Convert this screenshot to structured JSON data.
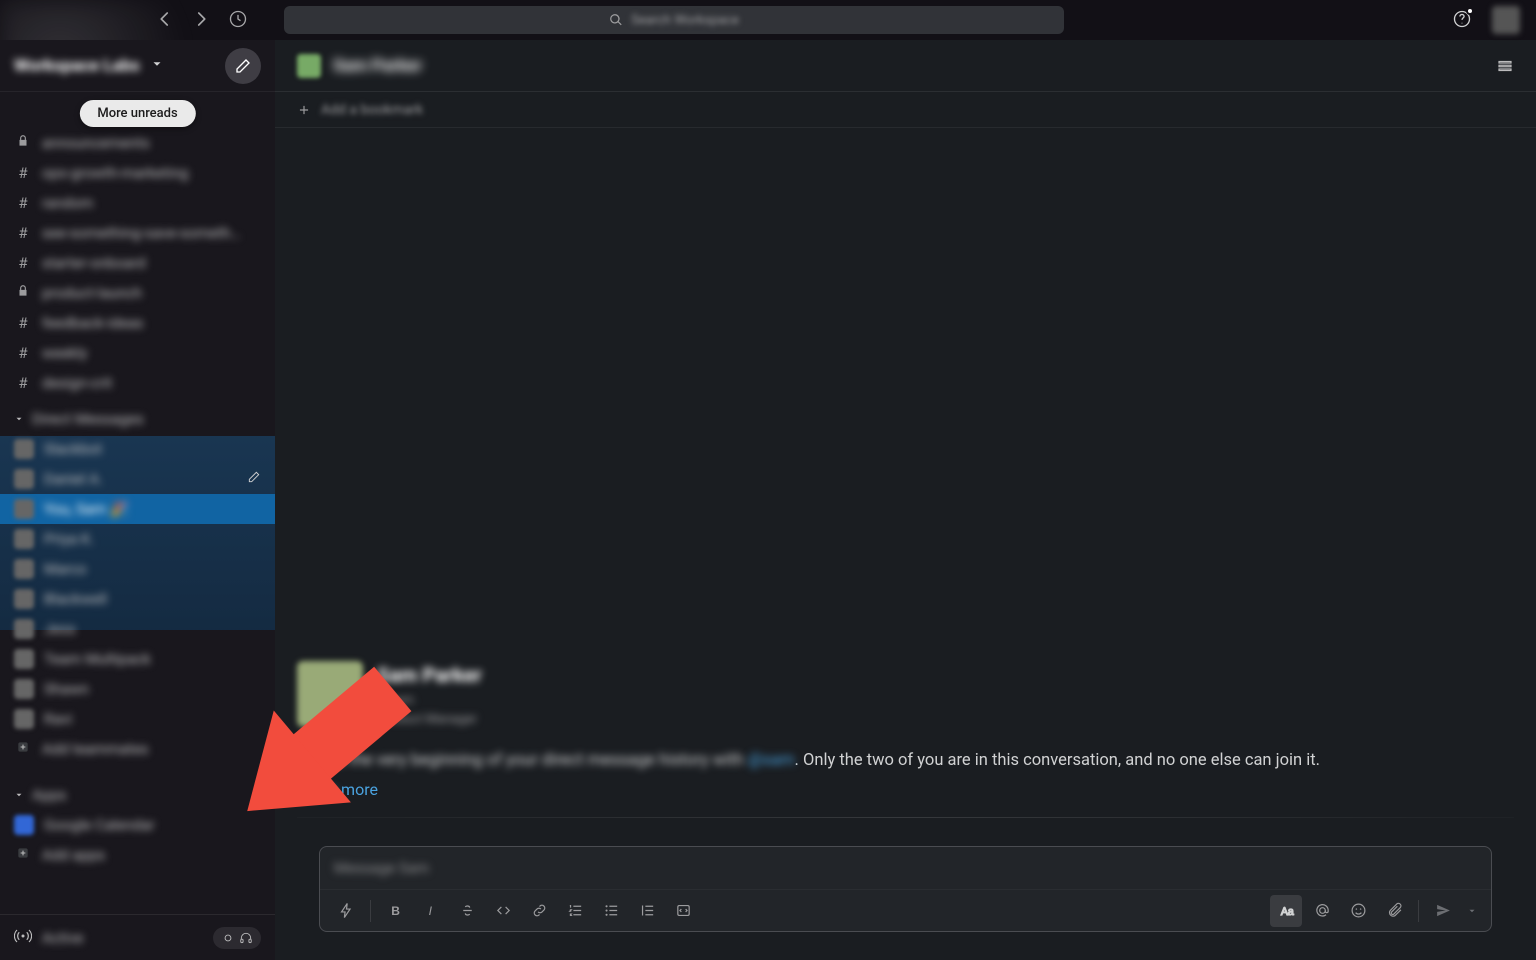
{
  "topbar": {
    "search_placeholder": "Search Workspace",
    "help_has_badge": true
  },
  "workspace": {
    "name": "Workspace Labs"
  },
  "sidebar": {
    "more_unreads_label": "More unreads",
    "channels": [
      {
        "kind": "lock",
        "label": "announcements"
      },
      {
        "kind": "hash",
        "label": "ops-growth-marketing"
      },
      {
        "kind": "hash",
        "label": "random"
      },
      {
        "kind": "hash",
        "label": "see-something-save-someth…"
      },
      {
        "kind": "hash",
        "label": "starter-onboard"
      },
      {
        "kind": "lock",
        "label": "product-launch"
      },
      {
        "kind": "hash",
        "label": "feedback-ideas"
      },
      {
        "kind": "hash",
        "label": "weekly"
      },
      {
        "kind": "hash",
        "label": "design-crit"
      }
    ],
    "dm_section_label": "Direct Messages",
    "dms": [
      {
        "label": "Slackbot"
      },
      {
        "label": "Daniel A.",
        "show_edit": true
      },
      {
        "label": "You, Sam 🎉",
        "selected": true
      },
      {
        "label": "Priya K."
      },
      {
        "label": "Marco"
      },
      {
        "label": "Blackwell"
      },
      {
        "label": "Jess"
      },
      {
        "label": "Team Multipack"
      },
      {
        "label": "Shawn"
      },
      {
        "label": "Ravi"
      }
    ],
    "add_teammates_label": "Add teammates",
    "apps_section_label": "Apps",
    "apps": [
      {
        "label": "Google Calendar"
      },
      {
        "label": "Add apps"
      }
    ],
    "footer_label": "Active"
  },
  "channel_header": {
    "title": "Sam Parker",
    "add_bookmark_label": "Add a bookmark"
  },
  "dm_intro": {
    "display_name": "Sam Parker",
    "handle": "@sam",
    "title_line": "Product Manager",
    "line_prefix": "This is the very beginning of your direct message history with ",
    "mention": "@sam",
    "line_suffix": ". Only the two of you are in this conversation, and no one else can join it.",
    "learn_more_prefix": "Learn ",
    "learn_more": "more"
  },
  "composer": {
    "placeholder": "Message Sam"
  },
  "toolbar": {
    "bold_label": "B",
    "italic_label": "I"
  }
}
